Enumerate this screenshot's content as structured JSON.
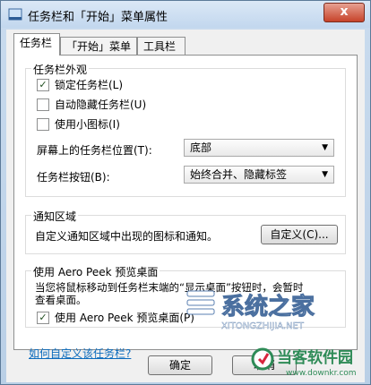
{
  "window": {
    "title": "任务栏和「开始」菜单属性",
    "close_label": "x"
  },
  "tabs": [
    {
      "label": "任务栏"
    },
    {
      "label": "「开始」菜单"
    },
    {
      "label": "工具栏"
    }
  ],
  "appearance": {
    "legend": "任务栏外观",
    "lock_taskbar": "锁定任务栏(L)",
    "auto_hide": "自动隐藏任务栏(U)",
    "small_icons": "使用小图标(I)",
    "location_label": "屏幕上的任务栏位置(T):",
    "location_value": "底部",
    "buttons_label": "任务栏按钮(B):",
    "buttons_value": "始终合并、隐藏标签"
  },
  "notification": {
    "legend": "通知区域",
    "text": "自定义通知区域中出现的图标和通知。",
    "customize_label": "自定义(C)..."
  },
  "aero": {
    "legend": "使用 Aero Peek 预览桌面",
    "desc_line1": "当您将鼠标移动到任务栏末端的“显示桌面”按钮时，会暂时",
    "desc_line2": "查看桌面。",
    "checkbox_label": "使用 Aero Peek 预览桌面(P)"
  },
  "link_text": "如何自定义该任务栏?",
  "footer": {
    "ok_label": "确定",
    "cancel_label": "取消"
  },
  "watermarks": {
    "logo1_text": "系统之家",
    "logo1_sub": "XITONGZHIJIA.NET",
    "logo2_text": "当客软件园",
    "logo2_sub": "www.downkr.com"
  }
}
